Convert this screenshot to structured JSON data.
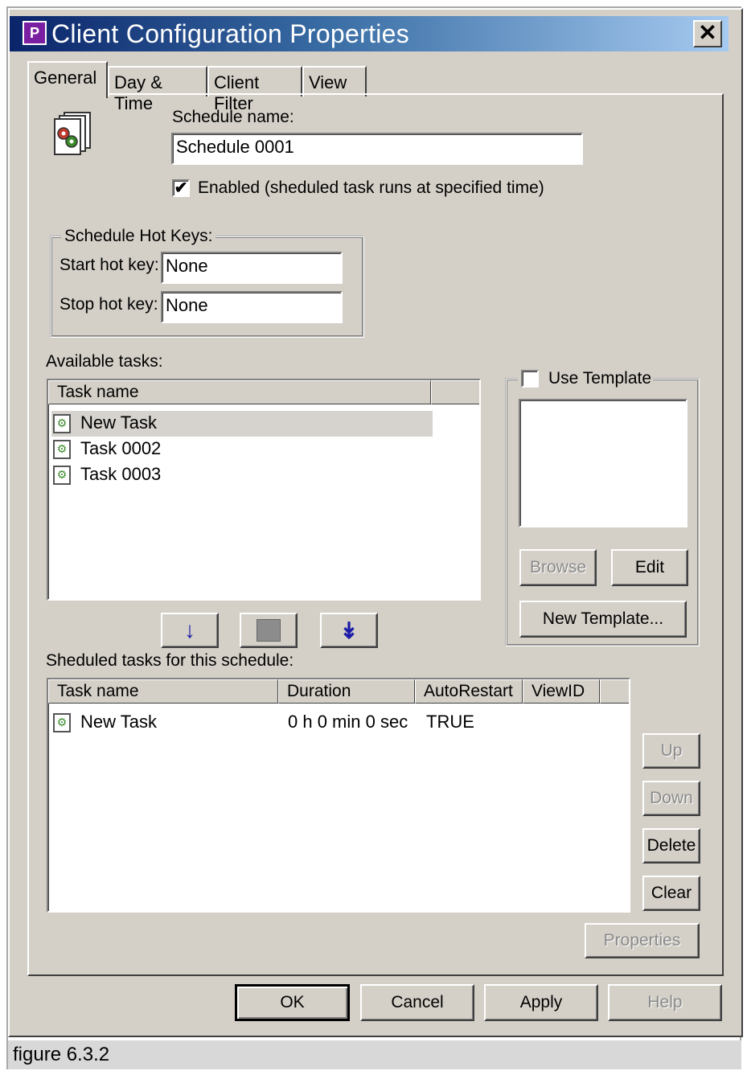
{
  "window": {
    "title": "Client Configuration Properties",
    "icon_letter": "P",
    "close_glyph": "✕"
  },
  "tabs": [
    {
      "label": "General",
      "active": true
    },
    {
      "label": "Day & Time",
      "active": false
    },
    {
      "label": "Client Filter",
      "active": false
    },
    {
      "label": "View",
      "active": false
    }
  ],
  "schedule": {
    "name_label": "Schedule name:",
    "name_value": "Schedule 0001",
    "enabled_checked": true,
    "enabled_label": "Enabled (sheduled task runs at specified time)"
  },
  "hotkeys": {
    "group_title": "Schedule Hot Keys:",
    "start_label": "Start hot key:",
    "start_value": "None",
    "stop_label": "Stop hot key:",
    "stop_value": "None"
  },
  "available": {
    "label": "Available tasks:",
    "column": "Task name",
    "rows": [
      {
        "name": "New Task",
        "selected": true
      },
      {
        "name": "Task 0002",
        "selected": false
      },
      {
        "name": "Task 0003",
        "selected": false
      }
    ]
  },
  "transfer_icons": [
    "arrow-down-icon",
    "stop-square-icon",
    "double-arrow-down-icon"
  ],
  "template": {
    "checkbox_label": "Use Template",
    "checked": false,
    "browse_label": "Browse",
    "edit_label": "Edit",
    "new_label": "New Template..."
  },
  "scheduled": {
    "label": "Sheduled tasks for this schedule:",
    "columns": [
      "Task name",
      "Duration",
      "AutoRestart",
      "ViewID"
    ],
    "rows": [
      {
        "name": "New Task",
        "duration": "0 h 0 min 0 sec",
        "autorestart": "TRUE",
        "viewid": ""
      }
    ]
  },
  "side_buttons": {
    "up": "Up",
    "down": "Down",
    "delete": "Delete",
    "clear": "Clear",
    "properties": "Properties"
  },
  "footer_buttons": {
    "ok": "OK",
    "cancel": "Cancel",
    "apply": "Apply",
    "help": "Help"
  },
  "caption": "figure 6.3.2",
  "colors": {
    "dialog_bg": "#d4d0c8",
    "title_start": "#0a246a",
    "title_end": "#a6caf0",
    "disabled_text": "#8a8a8a"
  }
}
